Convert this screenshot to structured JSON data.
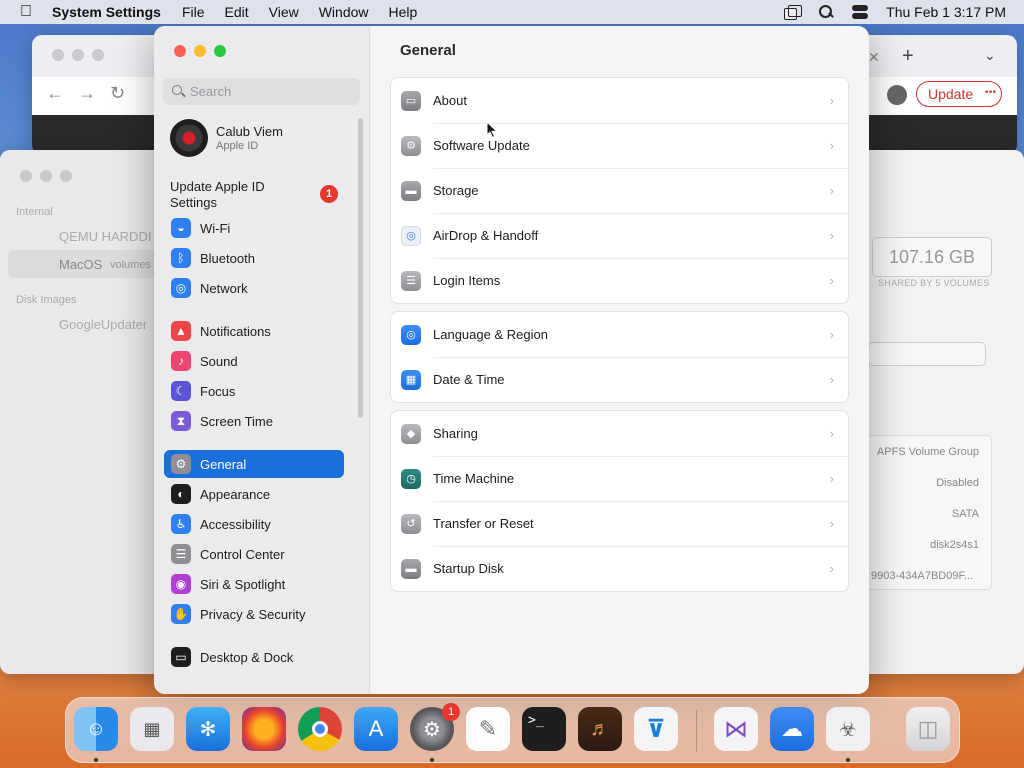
{
  "menubar": {
    "app_name": "System Settings",
    "menus": [
      "File",
      "Edit",
      "View",
      "Window",
      "Help"
    ],
    "clock": "Thu Feb 1  3:17 PM"
  },
  "browser": {
    "update_label": "Update"
  },
  "disk_utility": {
    "internal_label": "Internal",
    "item_qemu": "QEMU HARDDI",
    "item_macos": "MacOS",
    "item_macos_sub": "volumes",
    "disk_images_label": "Disk Images",
    "item_google": "GoogleUpdater",
    "capacity": "107.16 GB",
    "capacity_sub": "SHARED BY 5 VOLUMES",
    "details": [
      "APFS Volume Group",
      "Disabled",
      "SATA",
      "disk2s4s1",
      "9903-434A7BD09F..."
    ]
  },
  "settings": {
    "search_placeholder": "Search",
    "profile": {
      "name": "Calub Viem",
      "sub": "Apple ID"
    },
    "update_apple_id": "Update Apple ID Settings",
    "update_badge": "1",
    "sidebar": [
      {
        "label": "Wi-Fi",
        "icon": "wifi-icon",
        "color": "#2f7ff0"
      },
      {
        "label": "Bluetooth",
        "icon": "bluetooth-icon",
        "color": "#2f7ff0"
      },
      {
        "label": "Network",
        "icon": "network-globe-icon",
        "color": "#2f7ff0"
      },
      {
        "label": "Notifications",
        "icon": "notifications-bell-icon",
        "color": "#ec4646"
      },
      {
        "label": "Sound",
        "icon": "sound-speaker-icon",
        "color": "#ec4670"
      },
      {
        "label": "Focus",
        "icon": "focus-moon-icon",
        "color": "#5b55d6"
      },
      {
        "label": "Screen Time",
        "icon": "screen-time-hourglass-icon",
        "color": "#7c5bd6"
      },
      {
        "label": "General",
        "icon": "general-gear-icon",
        "color": "#8e8e93"
      },
      {
        "label": "Appearance",
        "icon": "appearance-icon",
        "color": "#1d1d1f"
      },
      {
        "label": "Accessibility",
        "icon": "accessibility-icon",
        "color": "#2f7ff0"
      },
      {
        "label": "Control Center",
        "icon": "control-center-icon",
        "color": "#8e8e93"
      },
      {
        "label": "Siri & Spotlight",
        "icon": "siri-icon",
        "color": "#b03fd6"
      },
      {
        "label": "Privacy & Security",
        "icon": "privacy-hand-icon",
        "color": "#2f7ff0"
      },
      {
        "label": "Desktop & Dock",
        "icon": "desktop-dock-icon",
        "color": "#1d1d1f"
      }
    ],
    "active_item": "General",
    "main_title": "General",
    "groups": [
      [
        "About",
        "Software Update",
        "Storage",
        "AirDrop & Handoff",
        "Login Items"
      ],
      [
        "Language & Region",
        "Date & Time"
      ],
      [
        "Sharing",
        "Time Machine",
        "Transfer or Reset",
        "Startup Disk"
      ]
    ]
  },
  "dock": {
    "settings_badge": "1",
    "apps": [
      "Finder",
      "Launchpad",
      "Safari",
      "Firefox",
      "Chrome",
      "App Store",
      "System Settings",
      "TextEdit",
      "Terminal",
      "GarageBand",
      "VS Code",
      "Visual Studio",
      "Weather",
      "Disk Utility",
      "Trash"
    ]
  }
}
